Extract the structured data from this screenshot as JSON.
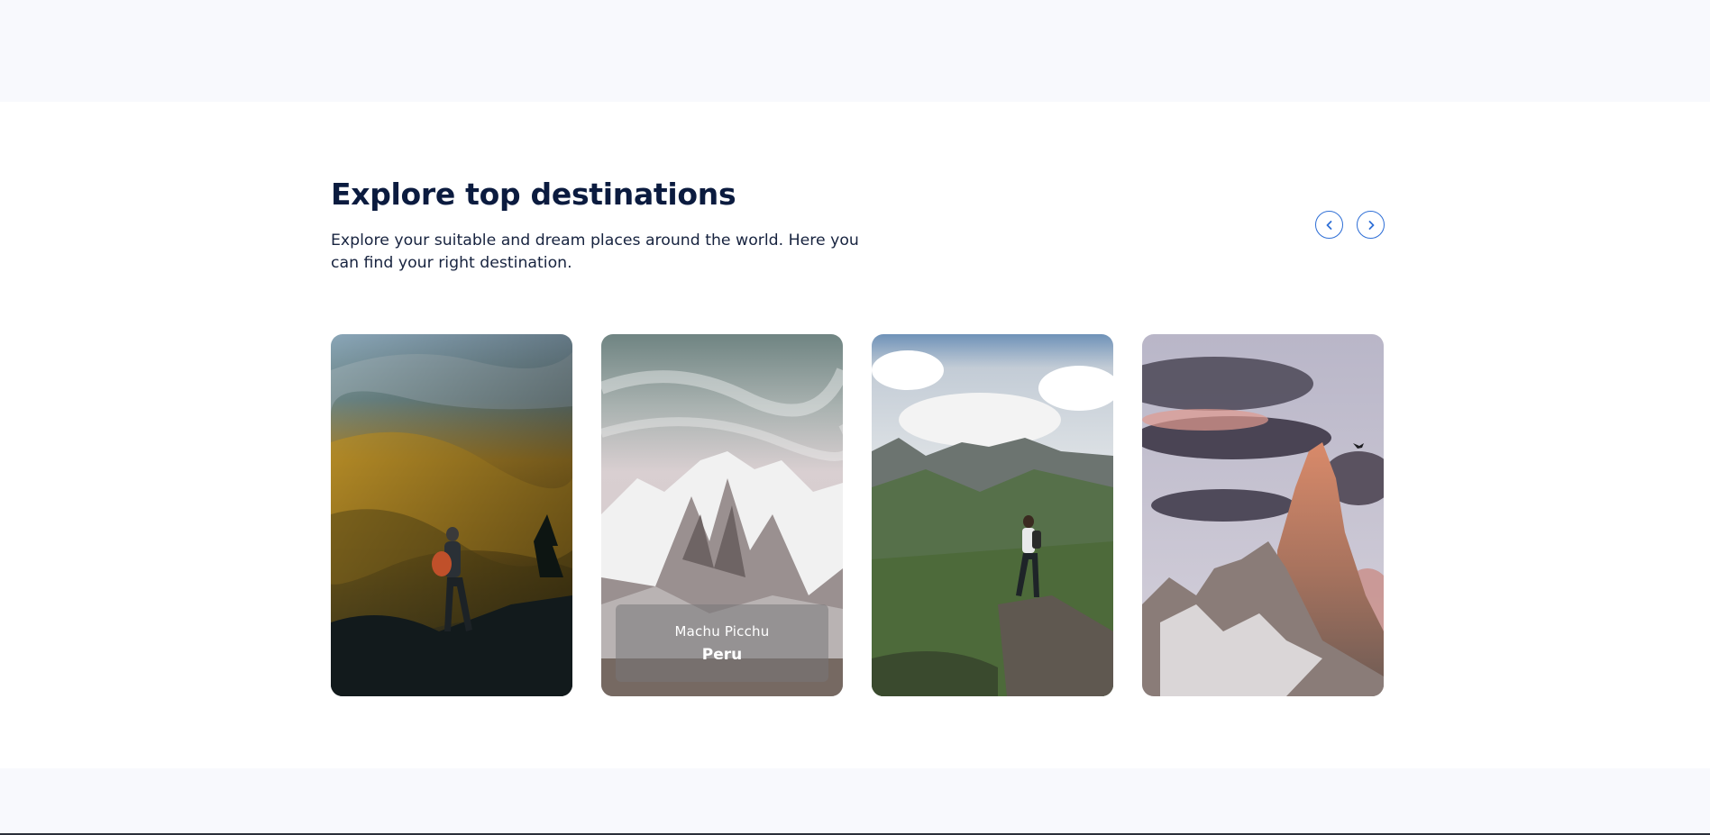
{
  "section": {
    "title": "Explore top destinations",
    "subtitle": "Explore your suitable and dream places around the world. Here you can find your right destination."
  },
  "navigation": {
    "prev_icon": "chevron-left-icon",
    "next_icon": "chevron-right-icon",
    "accent_color": "#2f6fd6"
  },
  "cards": [
    {
      "image": "hiker-golden-forest-valley"
    },
    {
      "image": "snowy-mountain-peak",
      "place": "Machu Picchu",
      "country": "Peru"
    },
    {
      "image": "hiker-on-rock-green-valley"
    },
    {
      "image": "sunset-rocky-spire"
    }
  ]
}
